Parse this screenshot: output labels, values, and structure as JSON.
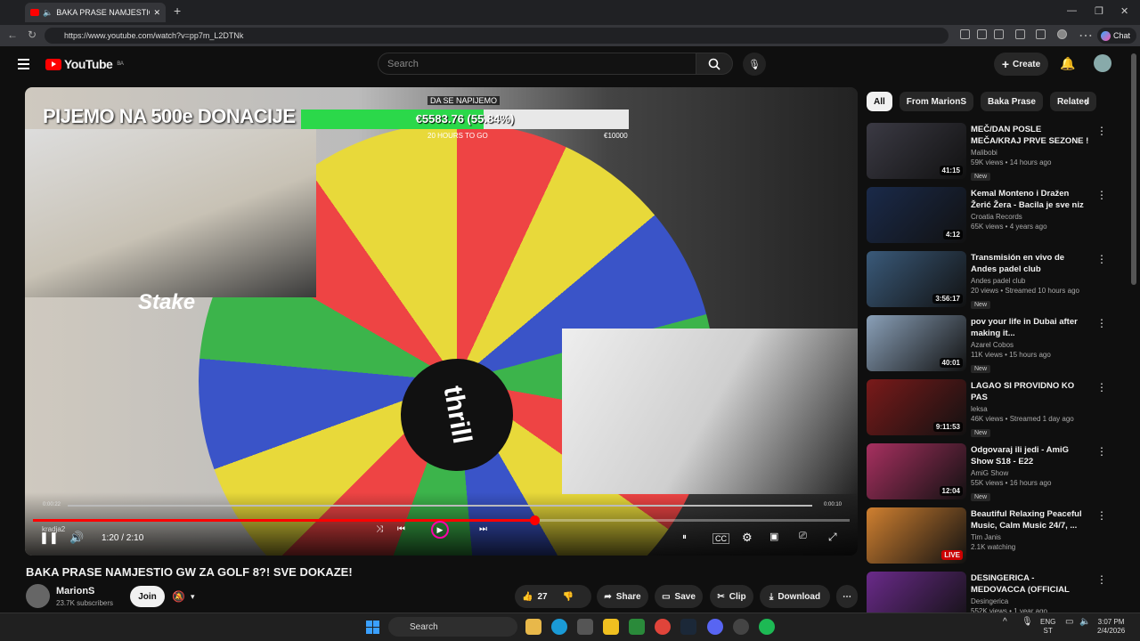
{
  "browser": {
    "tab_title": "BAKA PRASE NAMJESTIO GW",
    "url": "https://www.youtube.com/watch?v=pp7m_L2DTNk",
    "chat_label": "Chat"
  },
  "header": {
    "logo": "YouTube",
    "region": "BA",
    "search_placeholder": "Search",
    "create_label": "Create"
  },
  "video": {
    "overlay_banner": "PIJEMO NA 500e DONACIJE",
    "goal_top": "DA SE NAPIJEMO",
    "goal_text": "€5583.76 (55.84%)",
    "goal_fraction": 0.5584,
    "goal_bottom": "20 HOURS TO GO",
    "goal_max": "€10000",
    "stake_logo": "Stake",
    "hub_text": "thrill",
    "clip_start": "0:00:22",
    "clip_end": "0:00:10",
    "clip_label": "kradja2",
    "time": "1:20 / 2:10",
    "progress_fraction": 0.615,
    "title": "BAKA PRASE NAMJESTIO GW ZA GOLF 8?! SVE DOKAZE!"
  },
  "channel": {
    "name": "MarionS",
    "subscribers": "23.7K subscribers",
    "join_label": "Join"
  },
  "actions": {
    "likes": "27",
    "share": "Share",
    "save": "Save",
    "clip": "Clip",
    "download": "Download"
  },
  "chips": [
    "All",
    "From MarionS",
    "Baka Prase",
    "Related"
  ],
  "recommendations": [
    {
      "title": "MEČ/DAN POSLE MEČA/KRAJ PRVE SEZONE !",
      "channel": "Malibobi",
      "meta": "59K views • 14 hours ago",
      "duration": "41:15",
      "badge": "New",
      "thumb": "#3b3a44"
    },
    {
      "title": "Kemal Monteno i Dražen Žerić Žera - Bacila je sve niz rijeku ...",
      "channel": "Croatia Records",
      "meta": "65K views • 4 years ago",
      "duration": "4:12",
      "badge": "",
      "thumb": "#1a2a4a"
    },
    {
      "title": "Transmisión en vivo de Andes padel club",
      "channel": "Andes padel club",
      "meta": "20 views • Streamed 10 hours ago",
      "duration": "3:56:17",
      "badge": "New",
      "thumb": "#3a5a7a"
    },
    {
      "title": "pov your life in Dubai after making it...",
      "channel": "Azarel Cobos",
      "meta": "11K views • 15 hours ago",
      "duration": "40:01",
      "badge": "New",
      "thumb": "#8aa0b8"
    },
    {
      "title": "LAGAO SI PROVIDNO KO PAS",
      "channel": "leksa",
      "meta": "46K views • Streamed 1 day ago",
      "duration": "9:11:53",
      "badge": "New",
      "thumb": "#7a1a1a"
    },
    {
      "title": "Odgovaraj ili jedi - AmiG Show S18 - E22",
      "channel": "AmiG Show",
      "meta": "55K views • 16 hours ago",
      "duration": "12:04",
      "badge": "New",
      "thumb": "#a83060"
    },
    {
      "title": "Beautiful Relaxing Peaceful Music, Calm Music 24/7, ...",
      "channel": "Tim Janis",
      "meta": "2.1K watching",
      "duration": "LIVE",
      "badge": "",
      "thumb": "#d08030"
    },
    {
      "title": "DESINGERICA - MEDOVACCA (OFFICIAL VIDEO)",
      "channel": "Desingerica",
      "meta": "552K views • 1 year ago",
      "duration": "",
      "badge": "",
      "thumb": "#6a2a8a"
    }
  ],
  "taskbar": {
    "search": "Search",
    "lang": "ENG",
    "lang2": "ST",
    "time": "3:07 PM",
    "date": "2/4/2026"
  }
}
